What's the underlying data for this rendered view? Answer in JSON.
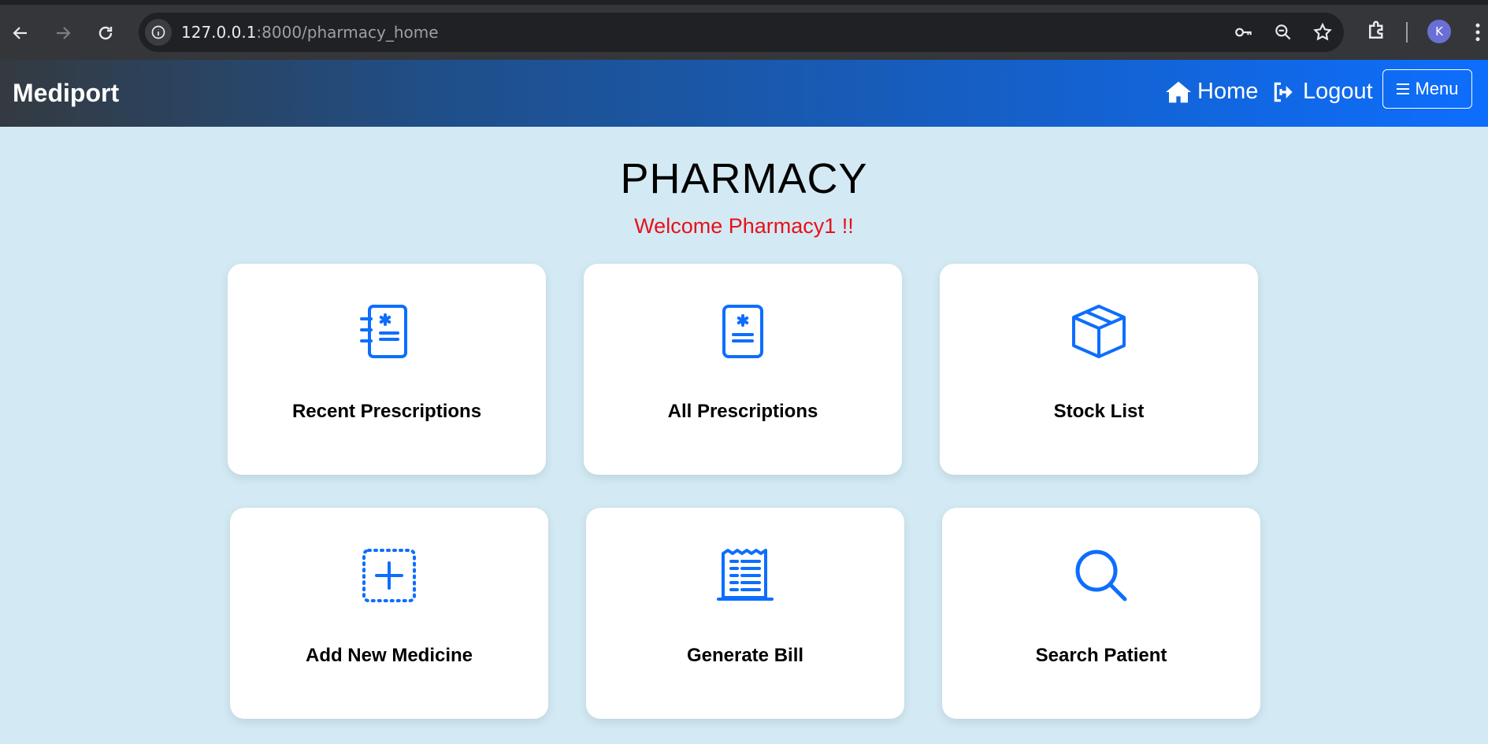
{
  "browser": {
    "url_host": "127.0.0.1",
    "url_path": ":8000/pharmacy_home",
    "profile_initial": "K"
  },
  "navbar": {
    "brand": "Mediport",
    "home_label": "Home",
    "logout_label": "Logout",
    "menu_label": "Menu"
  },
  "page": {
    "title": "PHARMACY",
    "welcome": "Welcome Pharmacy1 !!"
  },
  "cards": [
    {
      "label": "Recent Prescriptions",
      "icon": "prescription-list-icon"
    },
    {
      "label": "All Prescriptions",
      "icon": "prescription-icon"
    },
    {
      "label": "Stock List",
      "icon": "box-icon"
    },
    {
      "label": "Add New Medicine",
      "icon": "add-dotted-icon"
    },
    {
      "label": "Generate Bill",
      "icon": "receipt-icon"
    },
    {
      "label": "Search Patient",
      "icon": "search-icon"
    }
  ],
  "colors": {
    "accent": "#0d6efd",
    "background": "#d3eaf4",
    "welcome": "#e8101a"
  }
}
